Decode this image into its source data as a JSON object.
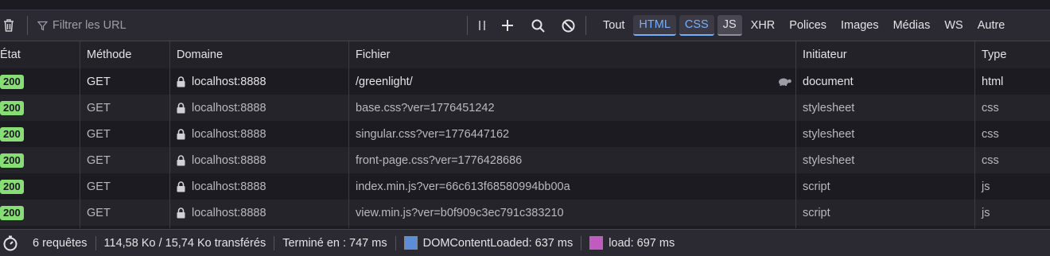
{
  "toolbar": {
    "filter_placeholder": "Filtrer les URL",
    "tabs": [
      "Tout",
      "HTML",
      "CSS",
      "JS",
      "XHR",
      "Polices",
      "Images",
      "Médias",
      "WS",
      "Autre"
    ]
  },
  "columns": [
    "État",
    "Méthode",
    "Domaine",
    "Fichier",
    "Initiateur",
    "Type"
  ],
  "rows": [
    {
      "status": "200",
      "method": "GET",
      "domain": "localhost:8888",
      "file": "/greenlight/",
      "initiator": "document",
      "type": "html"
    },
    {
      "status": "200",
      "method": "GET",
      "domain": "localhost:8888",
      "file": "base.css?ver=1776451242",
      "initiator": "stylesheet",
      "type": "css"
    },
    {
      "status": "200",
      "method": "GET",
      "domain": "localhost:8888",
      "file": "singular.css?ver=1776447162",
      "initiator": "stylesheet",
      "type": "css"
    },
    {
      "status": "200",
      "method": "GET",
      "domain": "localhost:8888",
      "file": "front-page.css?ver=1776428686",
      "initiator": "stylesheet",
      "type": "css"
    },
    {
      "status": "200",
      "method": "GET",
      "domain": "localhost:8888",
      "file": "index.min.js?ver=66c613f68580994bb00a",
      "initiator": "script",
      "type": "js"
    },
    {
      "status": "200",
      "method": "GET",
      "domain": "localhost:8888",
      "file": "view.min.js?ver=b0f909c3ec791c383210",
      "initiator": "script",
      "type": "js"
    }
  ],
  "statusbar": {
    "requests": "6 requêtes",
    "transferred": "114,58 Ko / 15,74 Ko transférés",
    "finished": "Terminé en : 747 ms",
    "domcontentloaded": "DOMContentLoaded: 637 ms",
    "load": "load: 697 ms"
  },
  "colors": {
    "status_ok": "#86de74",
    "accent": "#73b1ff",
    "dcl": "#5b8ed6",
    "load": "#c05cc0"
  }
}
